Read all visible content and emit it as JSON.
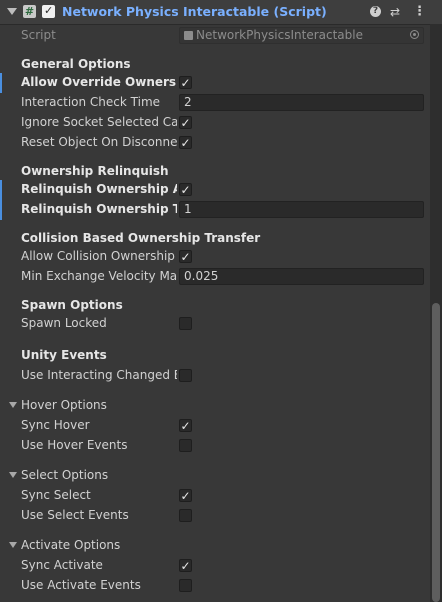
{
  "header": {
    "title": "Network Physics Interactable (Script)",
    "script_icon": "#",
    "enabled_check": "✓",
    "icons": [
      "foldout-arrow-icon",
      "script-icon",
      "enabled-checkbox",
      "help-icon",
      "preset-icon",
      "more-icon"
    ]
  },
  "script": {
    "label": "Script",
    "value": "NetworkPhysicsInteractable"
  },
  "general": {
    "title": "General Options",
    "allow_override": {
      "label": "Allow Override Ownership",
      "checked": "✓"
    },
    "interaction_check": {
      "label": "Interaction Check Time",
      "value": "2"
    },
    "ignore_socket": {
      "label": "Ignore Socket Selected Call",
      "checked": "✓"
    },
    "reset_object": {
      "label": "Reset Object On Disconnect",
      "checked": "✓"
    }
  },
  "relinquish": {
    "title": "Ownership Relinquish",
    "after": {
      "label": "Relinquish Ownership After",
      "checked": "✓"
    },
    "time": {
      "label": "Relinquish Ownership Time",
      "value": "1"
    }
  },
  "collision": {
    "title": "Collision Based Ownership Transfer",
    "allow": {
      "label": "Allow Collision Ownership E",
      "checked": "✓"
    },
    "min_velocity": {
      "label": "Min Exchange Velocity Magi",
      "value": "0.025"
    }
  },
  "spawn": {
    "title": "Spawn Options",
    "locked": {
      "label": "Spawn Locked",
      "checked": ""
    }
  },
  "unity_events": {
    "title": "Unity Events",
    "use_interacting": {
      "label": "Use Interacting Changed Ev",
      "checked": ""
    }
  },
  "hover": {
    "title": "Hover Options",
    "sync": {
      "label": "Sync Hover",
      "checked": "✓"
    },
    "events": {
      "label": "Use Hover Events",
      "checked": ""
    }
  },
  "select": {
    "title": "Select Options",
    "sync": {
      "label": "Sync Select",
      "checked": "✓"
    },
    "events": {
      "label": "Use Select Events",
      "checked": ""
    }
  },
  "activate": {
    "title": "Activate Options",
    "sync": {
      "label": "Sync Activate",
      "checked": "✓"
    },
    "events": {
      "label": "Use Activate Events",
      "checked": ""
    }
  },
  "colors": {
    "title_blue": "#7ab0ff",
    "modified_bar": "#4a8fe0",
    "background": "#383838"
  }
}
